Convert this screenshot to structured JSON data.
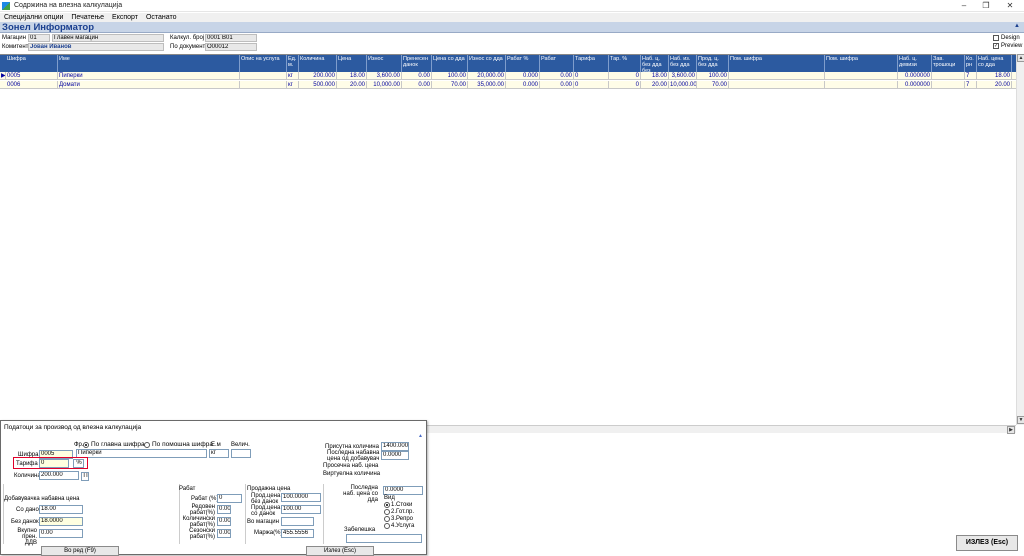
{
  "window": {
    "title": "Содржина на влезна калкулација",
    "minimize": "–",
    "maximize": "❐",
    "close": "✕"
  },
  "menu": [
    "Специјални опции",
    "Печатење",
    "Експорт",
    "Останато"
  ],
  "company": {
    "name": "Зонел Информатор",
    "caret": "▲"
  },
  "header": {
    "warehouse_label": "Магацин",
    "warehouse_code": "01",
    "warehouse_name": "Главен магацин",
    "client_label": "Комитент",
    "client_name": "Јован Иванов",
    "calc_label": "Калкул. број",
    "calc_number": "0001 B01",
    "doc_label": "По документ",
    "doc_number": "O00012",
    "design_label": "Design",
    "preview_label": "Preview",
    "design_checked": false,
    "preview_checked": true
  },
  "grid": {
    "columns": [
      "Шифра",
      "Име",
      "Опис на услуга",
      "Ед. м.",
      "Количина",
      "Цена",
      "Износ",
      "Пренесен данок",
      "Цена со дда",
      "Износ со дда",
      "Рабат %",
      "Рабат",
      "Тарифа",
      "Тар. %",
      "Наб. ц. без дда без",
      "Наб. из. без дда",
      "Прод. ц. без дда",
      "Пом. шифра",
      "Пом. шифра",
      "Наб. ц. девизи",
      "Зав. трошоци",
      "Ко. рн",
      "Наб. цена со дда"
    ],
    "rows": [
      {
        "cells": [
          "0005",
          "Пиперки",
          "",
          "кг",
          "200.000",
          "18.00",
          "3,600.00",
          "0.00",
          "100.00",
          "20,000.00",
          "0.000",
          "0.00",
          "0",
          "0",
          "18.00",
          "3,600.00",
          "100.00",
          "",
          "",
          "0.000000",
          "",
          "7",
          "18.00"
        ],
        "current": true
      },
      {
        "cells": [
          "0006",
          "Домати",
          "",
          "кг",
          "500.000",
          "20.00",
          "10,000.00",
          "0.00",
          "70.00",
          "35,000.00",
          "0.000",
          "0.00",
          "0",
          "0",
          "20.00",
          "10,000.00",
          "70.00",
          "",
          "",
          "0.000000",
          "",
          "7",
          "20.00"
        ],
        "current": false
      }
    ]
  },
  "scroll": {
    "up": "▲",
    "down": "▼",
    "right": "▶"
  },
  "panel": {
    "title": "Податоци за производ од влезна калкулација",
    "caret": "▲",
    "fr_label": "Фр.",
    "radio_main": "По главна шифра",
    "radio_aux": "По помошна шифра",
    "code_label": "Шифра",
    "code": "0005",
    "name": "Пиперки",
    "unit_label": "Е.м",
    "unit": "кг",
    "size_label": "Велич.",
    "size": "",
    "tariff_label": "Тарифа",
    "tariff": "0",
    "tariff_pct": "%",
    "qty_label": "Количина",
    "qty": "200.000",
    "qty_btn": "П",
    "present_qty_label": "Присутна количина",
    "present_qty": "1400.000",
    "last_price_label": "Последна набавна цена од добавувач",
    "last_price": "0.0000",
    "avg_price_label": "Просечна наб. цена",
    "virtual_qty_label": "Виртуелна количина",
    "supplier_section": "Добавувачка набавна цена",
    "with_tax_label": "Со данок",
    "with_tax": "18.00",
    "without_tax_label": "Без данок",
    "without_tax": "18.0000",
    "total_label": "Вкупно прен. ДДВ",
    "total": "0.00",
    "rabat_section": "Рабат",
    "rabat_pct_label": "Рабат (%)",
    "rabat_pct": "0",
    "regular_label": "Редовен рабат(%)",
    "regular": "0.00",
    "qty_rabat_label": "Количински рабат(%)",
    "qty_rabat": "0.00",
    "season_label": "Сезонски рабат(%)",
    "season": "0.00",
    "sale_section": "Продажна цена",
    "sale_no_tax_label": "Прод.цена без данок",
    "sale_no_tax": "100.0000",
    "sale_with_tax_label": "Прод.цена со данок",
    "sale_with_tax": "100.00",
    "in_store_label": "Во магацин",
    "in_store": "",
    "margin_label": "Маржа(%)",
    "margin": "455.5556",
    "last_buy_label": "Последна наб. цена со дда",
    "last_buy": "0.0000",
    "kind_label": "Вид",
    "kinds": [
      "1.Стоки",
      "2.Гот.пр.",
      "3.Репро",
      "4.Услуга"
    ],
    "note_label": "Забелешка",
    "note": "",
    "btn_ok": "Во ред (F9)",
    "btn_exit": "Излез (Esc)"
  },
  "exit_button": "ИЗЛЕЗ (Esc)"
}
